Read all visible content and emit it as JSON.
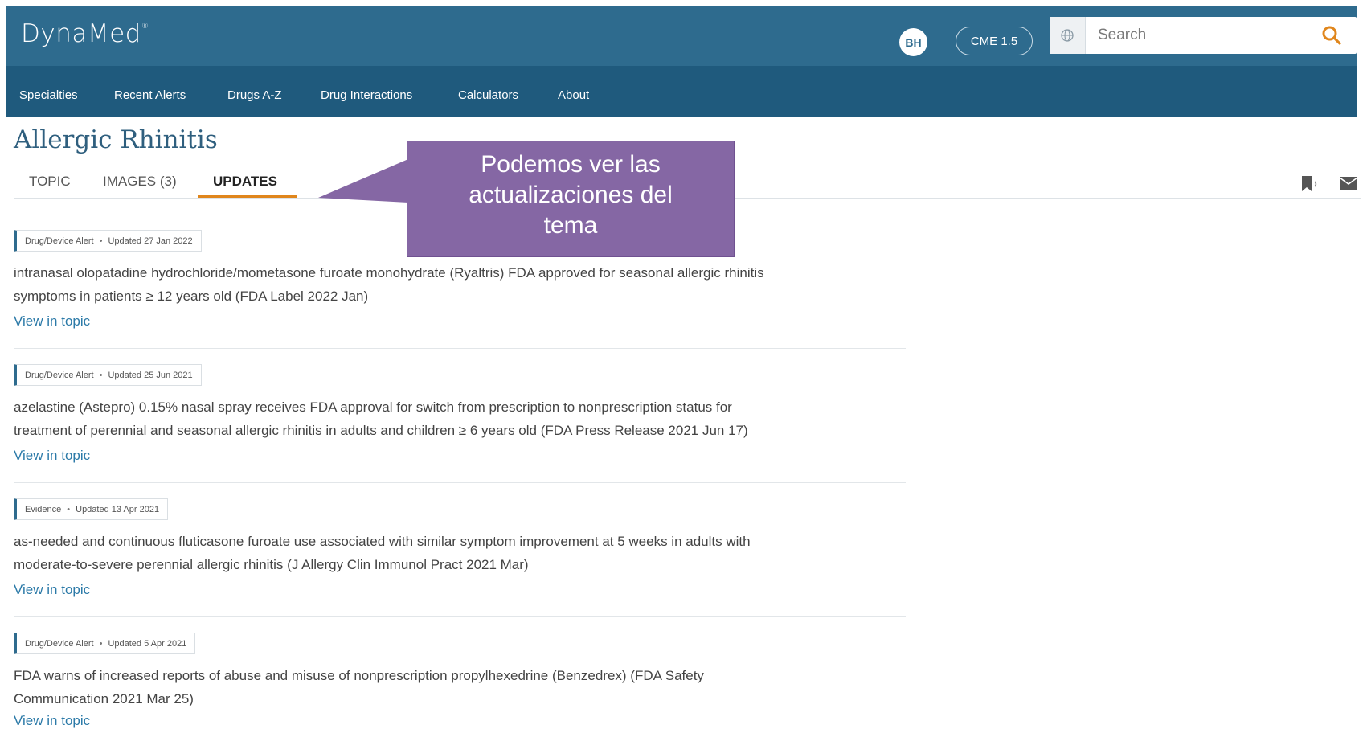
{
  "header": {
    "brand": "DynaMed",
    "brand_mark": "®",
    "avatar_initials": "BH",
    "cme_label": "CME 1.5",
    "search_placeholder": "Search"
  },
  "nav": {
    "items": [
      "Specialties",
      "Recent Alerts",
      "Drugs A-Z",
      "Drug Interactions",
      "Calculators",
      "About"
    ]
  },
  "page": {
    "title": "Allergic Rhinitis",
    "tabs": [
      "TOPIC",
      "IMAGES (3)",
      "UPDATES"
    ],
    "active_tab": "UPDATES"
  },
  "callout": {
    "lines": [
      "Podemos ver las",
      "actualizaciones del",
      "tema"
    ]
  },
  "updates": [
    {
      "category": "Drug/Device Alert",
      "date": "Updated 27 Jan 2022",
      "lines": [
        "intranasal olopatadine hydrochloride/mometasone furoate monohydrate (Ryaltris) FDA approved for seasonal allergic rhinitis",
        "symptoms in patients ≥ 12 years old (FDA Label 2022 Jan)"
      ],
      "link": "View in topic"
    },
    {
      "category": "Drug/Device Alert",
      "date": "Updated 25 Jun 2021",
      "lines": [
        "azelastine (Astepro) 0.15% nasal spray receives FDA approval for switch from prescription to nonprescription status for",
        "treatment of perennial and seasonal allergic rhinitis in adults and children ≥ 6 years old (FDA Press Release 2021 Jun 17)"
      ],
      "link": "View in topic"
    },
    {
      "category": "Evidence",
      "date": "Updated 13 Apr 2021",
      "lines": [
        "as-needed and continuous fluticasone furoate use associated with similar symptom improvement at 5 weeks in adults with",
        "moderate-to-severe perennial allergic rhinitis (J Allergy Clin Immunol Pract 2021 Mar)"
      ],
      "link": "View in topic"
    },
    {
      "category": "Drug/Device Alert",
      "date": "Updated 5 Apr 2021",
      "lines": [
        "FDA warns of increased reports of abuse and misuse of nonprescription propylhexedrine (Benzedrex) (FDA Safety",
        "Communication 2021 Mar 25)"
      ],
      "link": "View in topic"
    }
  ],
  "colors": {
    "header_bg": "#2e6b8e",
    "nav_bg": "#1f5a7d",
    "active_tab_underline": "#e0861c",
    "callout_bg": "#8567a4",
    "link": "#2c7aa8"
  }
}
